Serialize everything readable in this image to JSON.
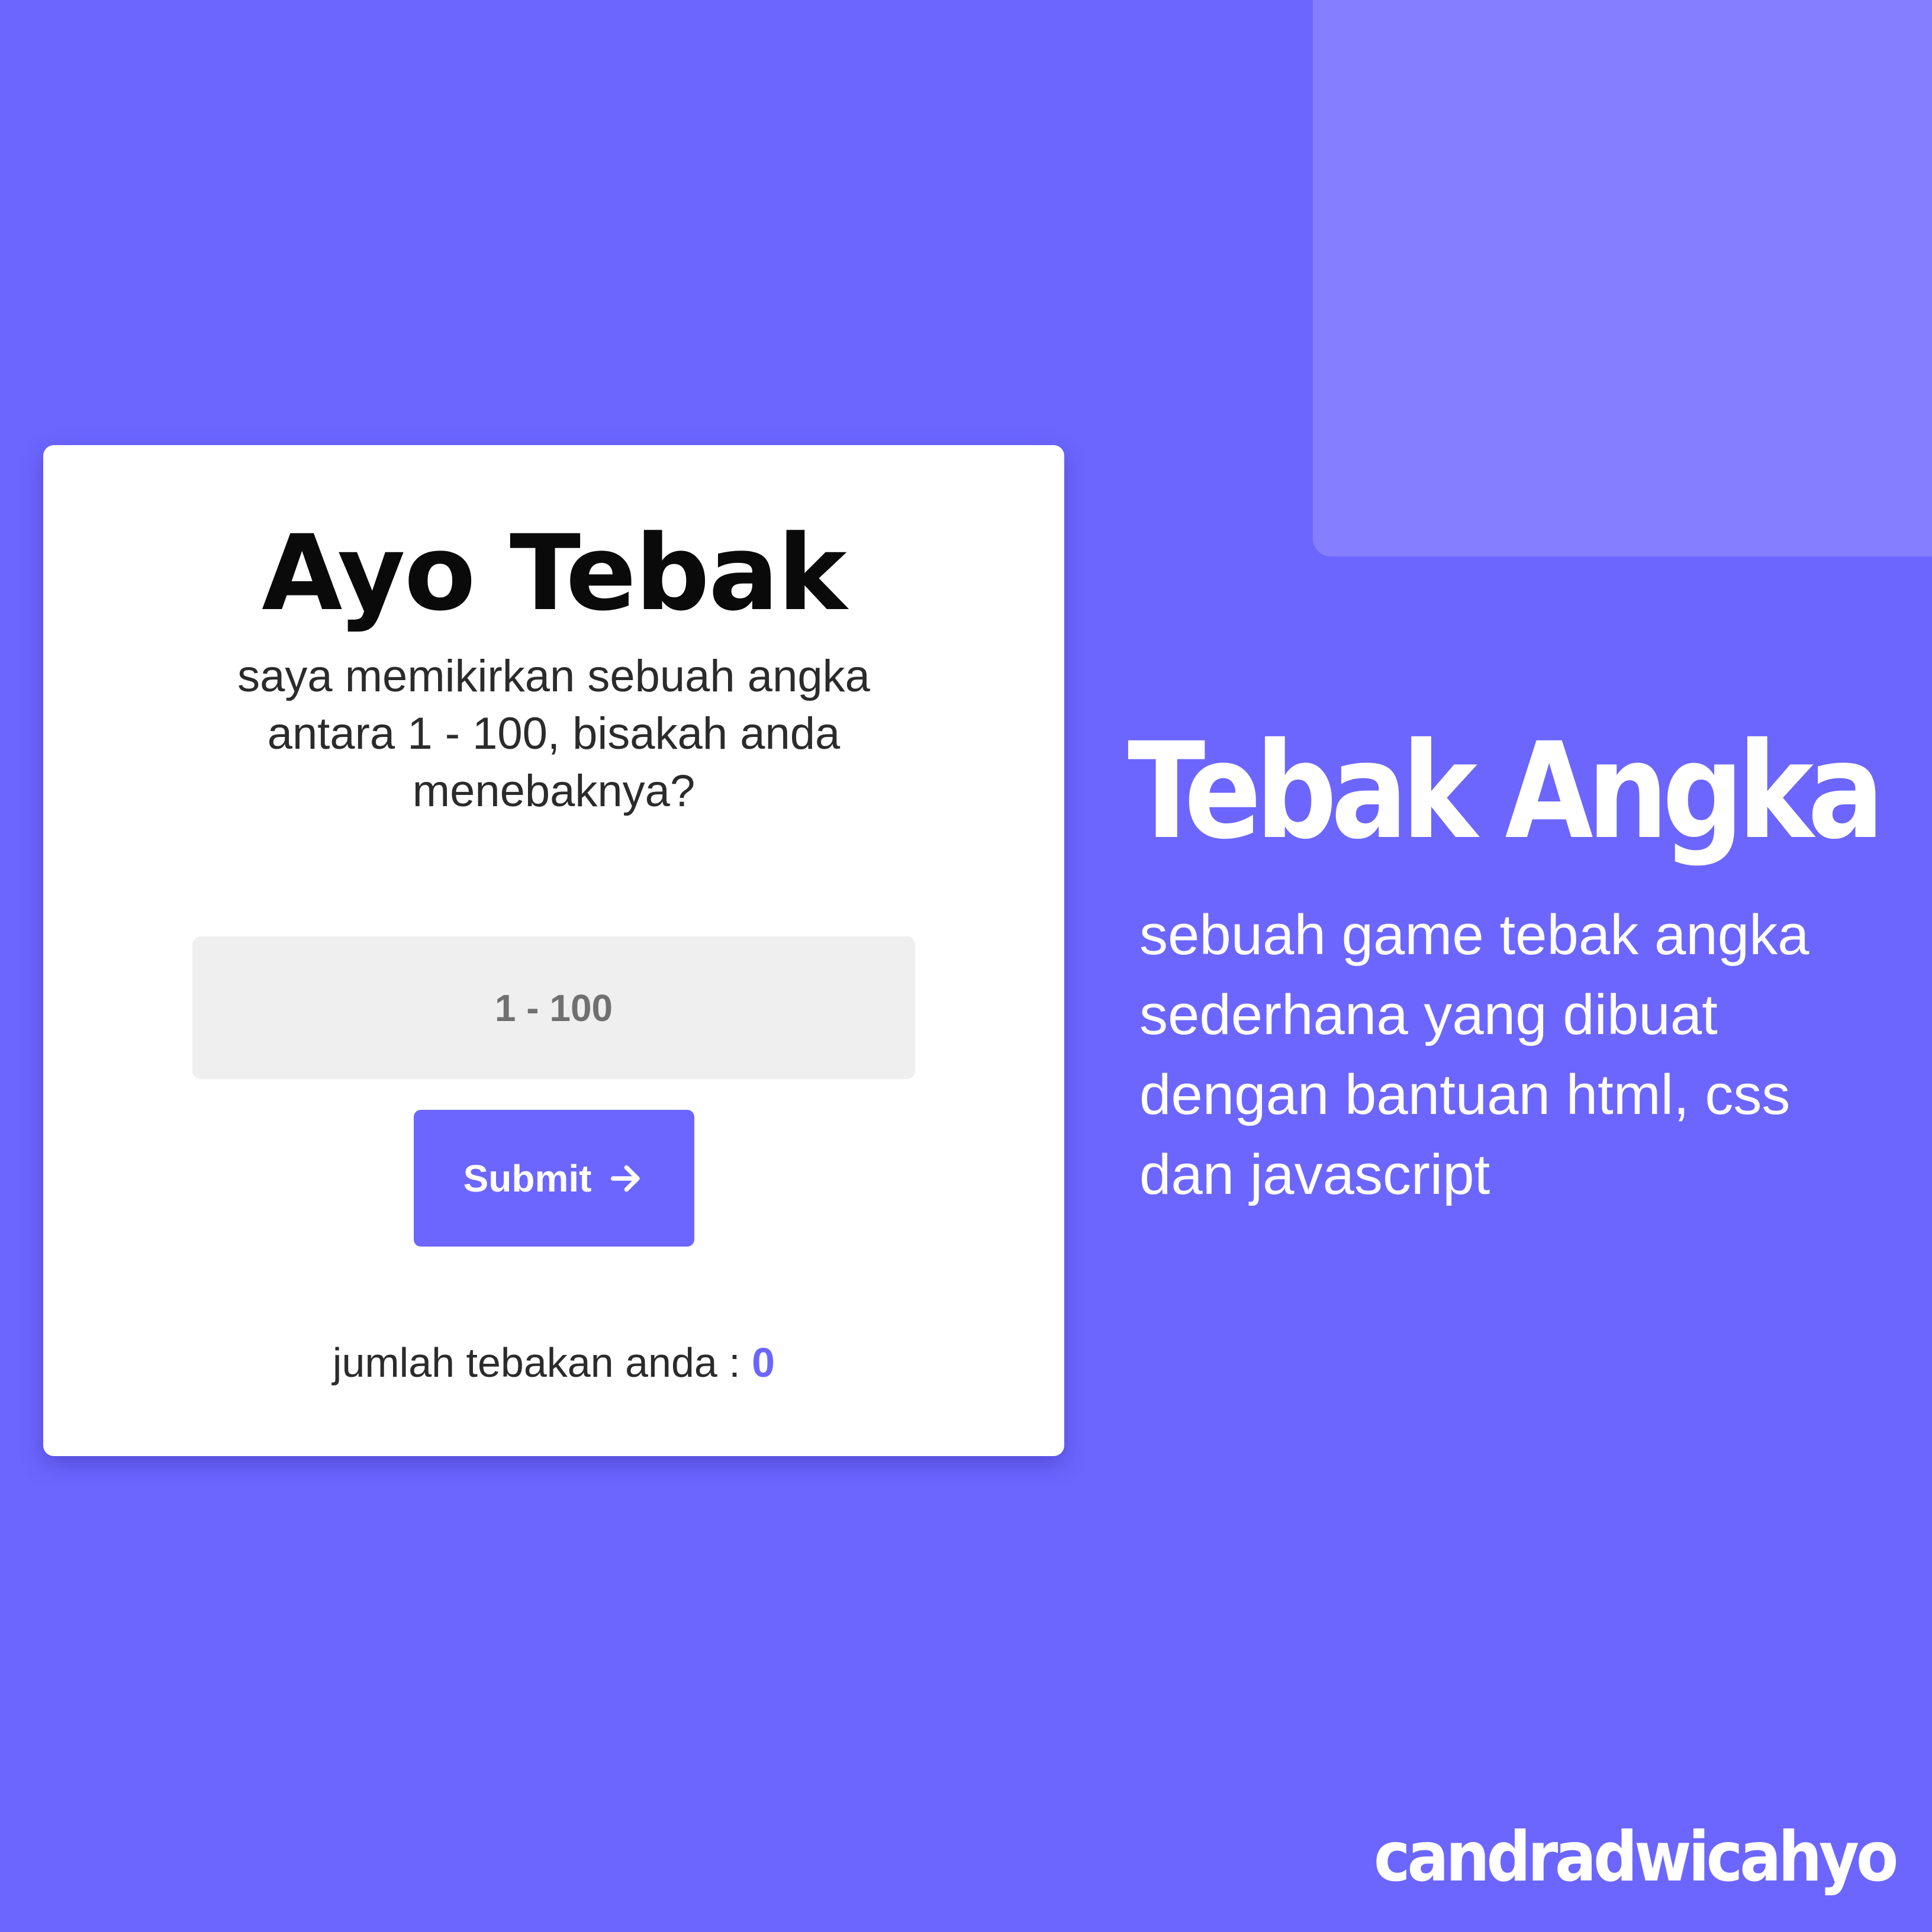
{
  "colors": {
    "background": "#6c66ff",
    "background_accent": "#857eff",
    "card": "#ffffff",
    "input_bg": "#efefef",
    "button": "#6c66ff",
    "count_value": "#6c66ff"
  },
  "card": {
    "title": "Ayo Tebak",
    "description": "saya memikirkan sebuah angka antara 1 - 100, bisakah anda menebaknya?",
    "input": {
      "placeholder": "1 - 100",
      "value": ""
    },
    "submit": {
      "label": "Submit",
      "icon": "arrow-right-icon"
    },
    "count": {
      "label": "jumlah tebakan anda : ",
      "value": "0"
    }
  },
  "promo": {
    "title": "Tebak Angka",
    "description": "sebuah game tebak angka sederhana yang dibuat dengan bantuan html, css dan javascript"
  },
  "author": "candradwicahyo"
}
